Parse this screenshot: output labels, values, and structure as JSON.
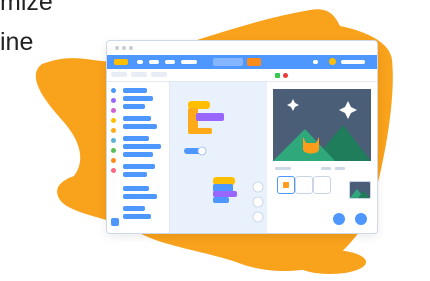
{
  "heading": {
    "line1": "mize",
    "line2": "ine"
  },
  "colors": {
    "blob": "#f9a21c",
    "menubar": "#4d97ff",
    "window_bg": "#ffffff",
    "script_area": "#e9f1fc",
    "stage_sky": "#4a5e78",
    "mountain_front": "#2fa97c",
    "mountain_back": "#1f7d5c",
    "cat_mark": "#ff9c1a",
    "motion_block": "#4d97ff",
    "looks_block": "#9966ff",
    "event_block": "#ffbf00",
    "go_flag": "#37c850",
    "stop_sign": "#ec3b3b"
  },
  "icons": {
    "go": "green-flag-icon",
    "stop": "stop-icon",
    "sparkles": "sparkle-icon",
    "cat": "cat-costume-icon"
  }
}
